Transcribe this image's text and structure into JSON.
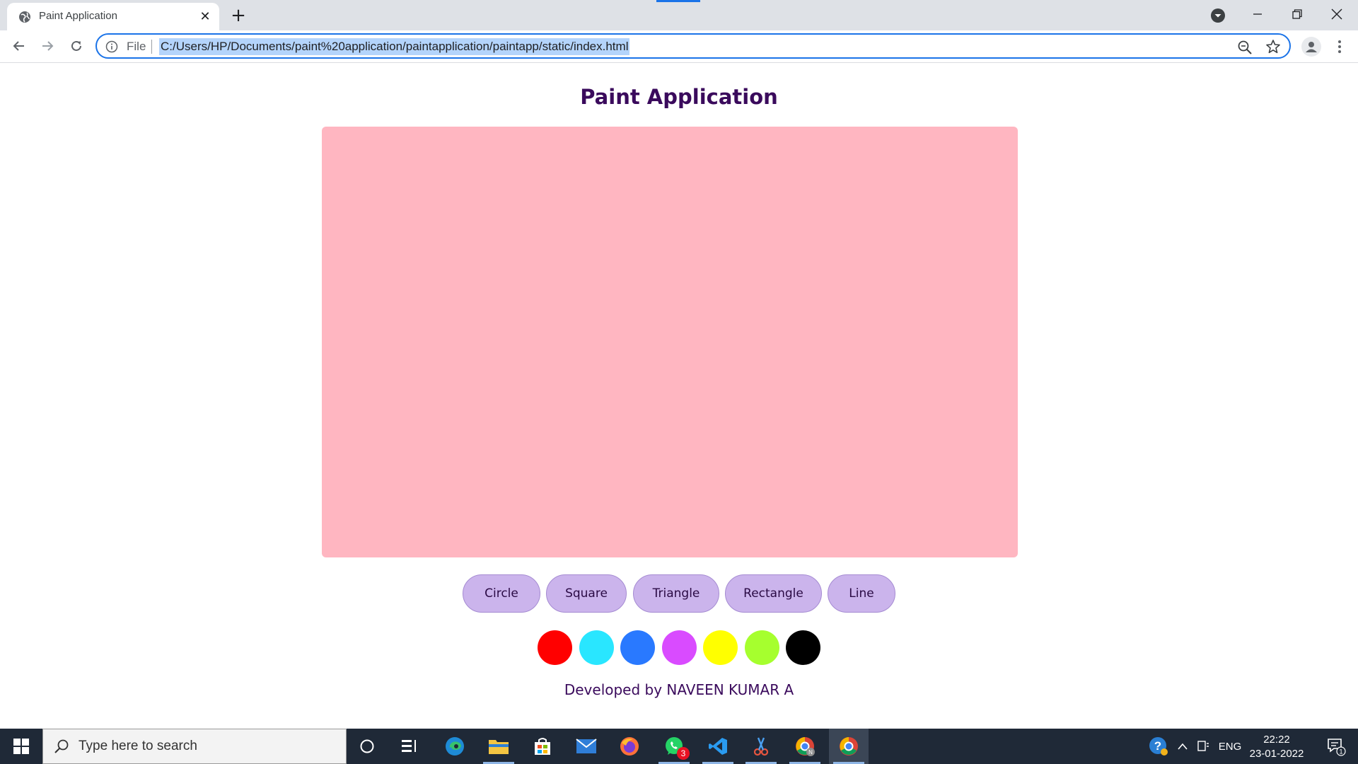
{
  "browser": {
    "tab_title": "Paint Application",
    "omnibox_scheme": "File",
    "url": "C:/Users/HP/Documents/paint%20application/paintapplication/paintapp/static/index.html"
  },
  "page": {
    "title": "Paint Application",
    "shape_buttons": [
      "Circle",
      "Square",
      "Triangle",
      "Rectangle",
      "Line"
    ],
    "colors": [
      "#ff0000",
      "#29e6ff",
      "#2979ff",
      "#d94bff",
      "#ffff00",
      "#a6ff2e",
      "#000000"
    ],
    "canvas_color": "#ffb6c1",
    "footer": "Developed by NAVEEN KUMAR A"
  },
  "taskbar": {
    "search_placeholder": "Type here to search",
    "whatsapp_badge": "3",
    "language": "ENG",
    "time": "22:22",
    "date": "23-01-2022",
    "notification_count": "1"
  }
}
